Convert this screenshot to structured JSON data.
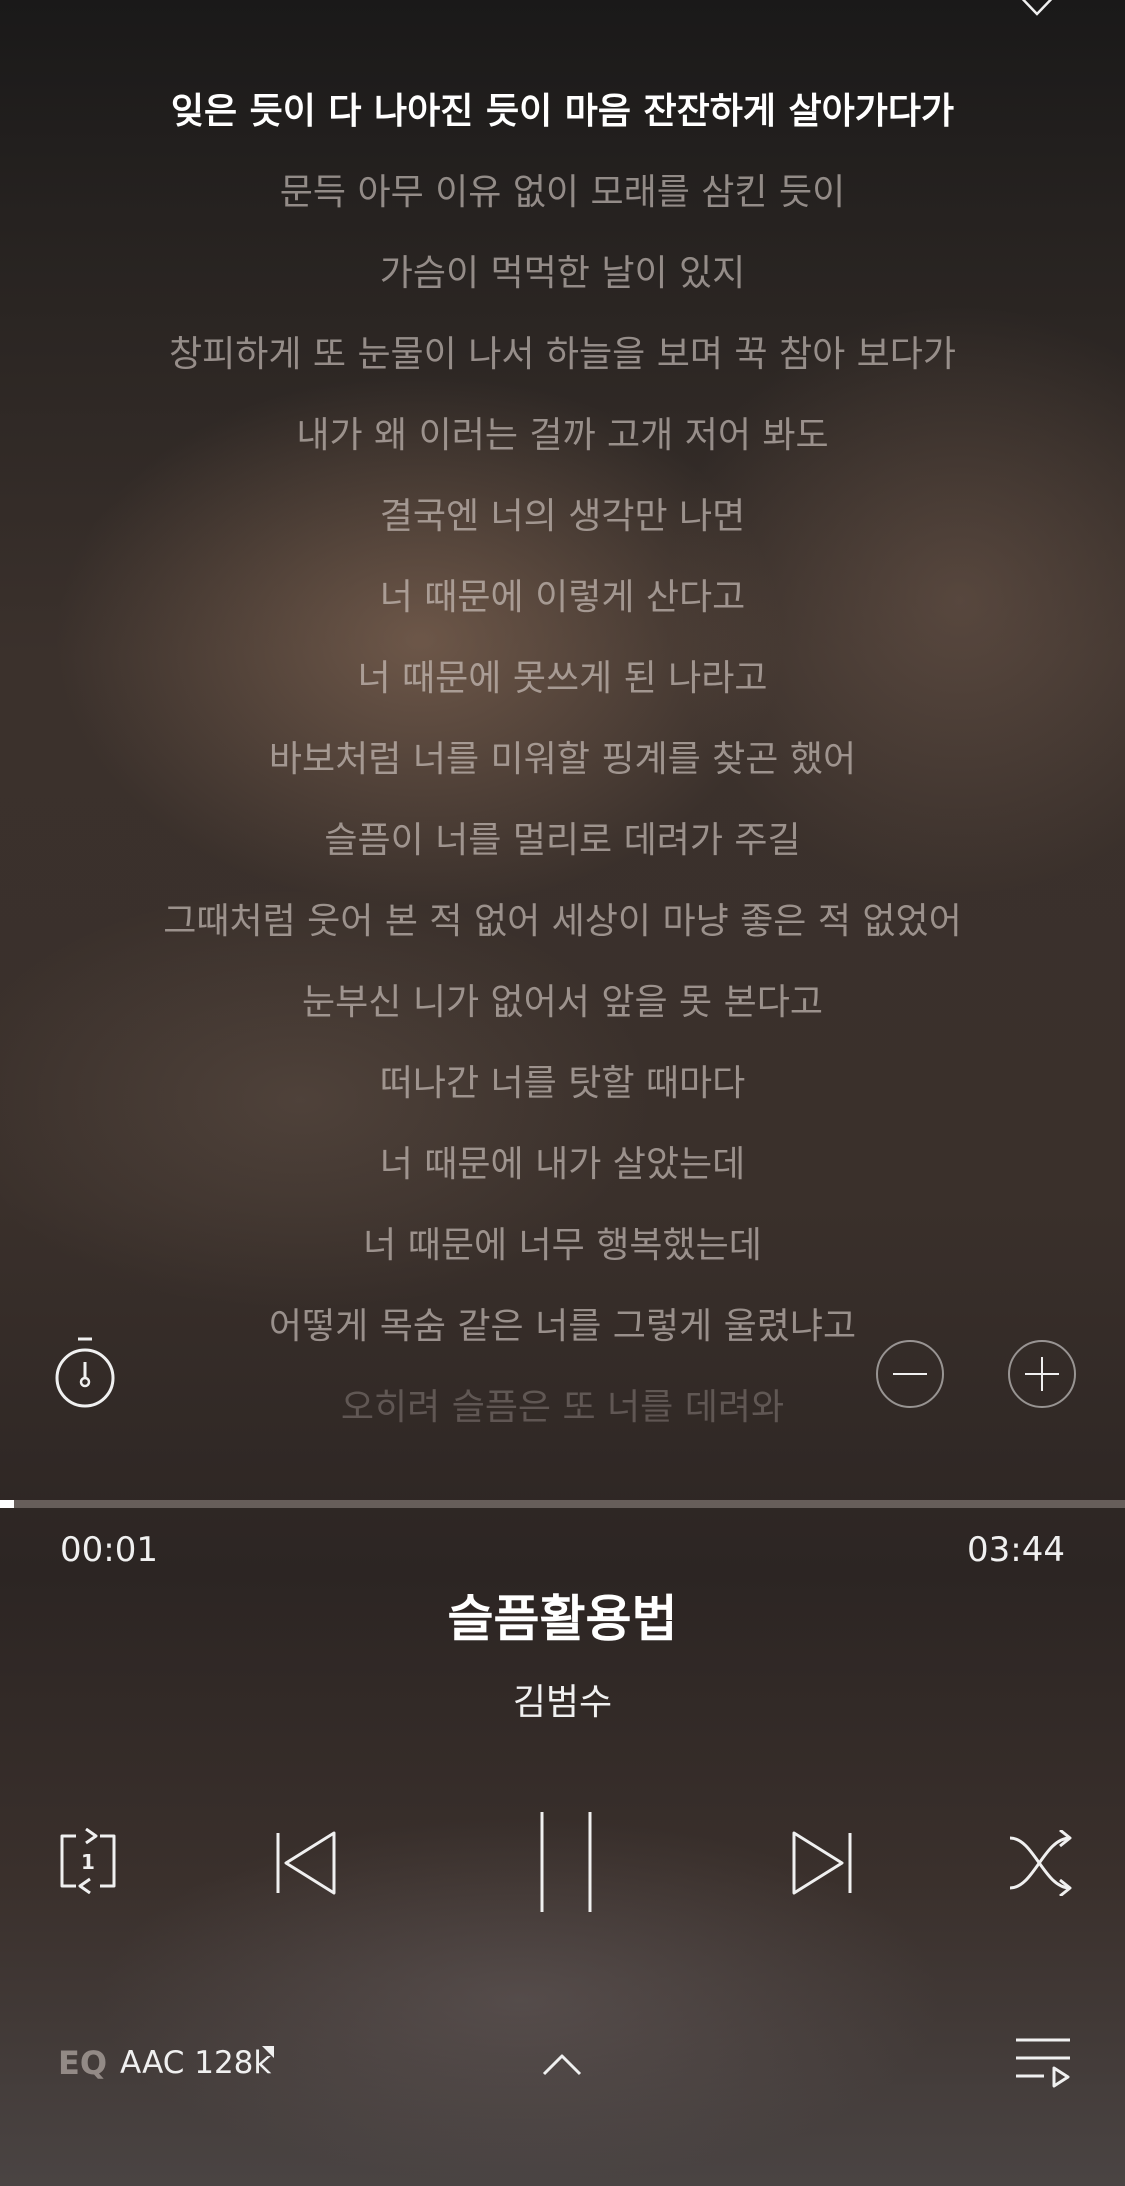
{
  "lyrics": {
    "current_index": 0,
    "lines": [
      "잊은 듯이 다 나아진 듯이 마음 잔잔하게 살아가다가",
      "문득 아무 이유 없이 모래를 삼킨 듯이",
      "가슴이 먹먹한 날이 있지",
      "창피하게 또 눈물이 나서 하늘을 보며 꾹 참아 보다가",
      "내가 왜 이러는 걸까 고개 저어 봐도",
      "결국엔 너의 생각만 나면",
      "너 때문에 이렇게 산다고",
      "너 때문에 못쓰게 된 나라고",
      "바보처럼 너를 미워할 핑계를 찾곤 했어",
      "슬픔이 너를 멀리로 데려가 주길",
      "그때처럼 웃어 본 적 없어 세상이 마냥 좋은 적 없었어",
      "눈부신 니가 없어서 앞을 못 본다고",
      "떠나간 너를 탓할 때마다",
      "너 때문에 내가 살았는데",
      "너 때문에 너무 행복했는데",
      "어떻게 목숨 같은 너를 그렇게 울렸냐고",
      "오히려 슬픔은 또 너를 데려와"
    ]
  },
  "icons": {
    "favorite": "heart-outline-icon",
    "timer": "sleep-timer-icon",
    "font_smaller": "minus-circle-icon",
    "font_larger": "plus-circle-icon",
    "repeat": "repeat-one-icon",
    "previous": "skip-previous-icon",
    "pause": "pause-icon",
    "next": "skip-next-icon",
    "shuffle": "shuffle-icon",
    "expand": "chevron-up-icon",
    "playlist": "playlist-icon"
  },
  "playback": {
    "progress_fraction": 0.0045,
    "elapsed": "00:01",
    "total": "03:44"
  },
  "track": {
    "title": "슬픔활용법",
    "artist": "김범수"
  },
  "controls": {
    "repeat_badge": "1"
  },
  "audio": {
    "eq_label": "EQ",
    "codec": "AAC 128k"
  },
  "colors": {
    "text_primary": "#ffffff",
    "text_dim": "#d7cdc8",
    "progress_fill": "#ffffff",
    "progress_track": "#968c87"
  }
}
